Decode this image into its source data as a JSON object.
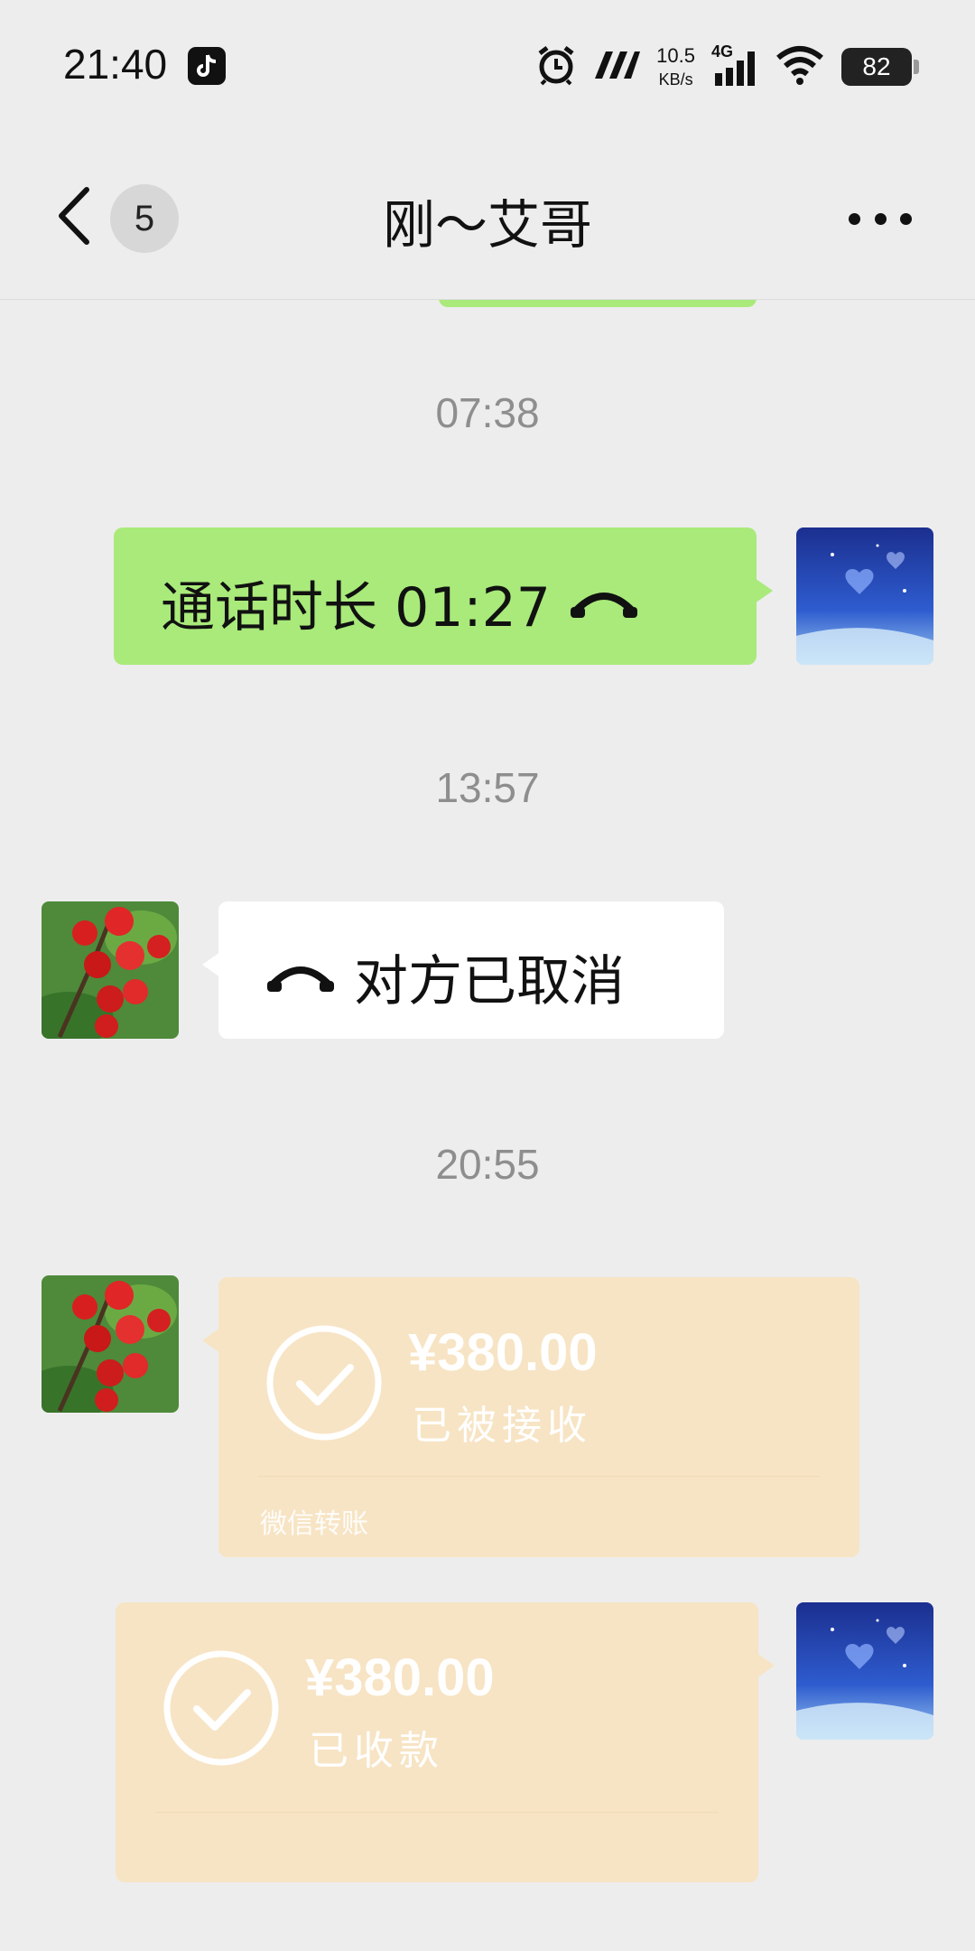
{
  "status_bar": {
    "time": "21:40",
    "net_speed": "10.5",
    "net_unit": "KB/s",
    "network": "4G",
    "battery": "82"
  },
  "nav": {
    "unread_count": "5",
    "title": "刚～艾哥"
  },
  "messages": {
    "ts1": "07:38",
    "call_duration_text": "通话时长 01:27",
    "ts2": "13:57",
    "call_cancel_text": "对方已取消",
    "ts3": "20:55",
    "transfer1": {
      "amount": "¥380.00",
      "status": "已被接收",
      "footer": "微信转账"
    },
    "transfer2": {
      "amount": "¥380.00",
      "status": "已收款"
    }
  },
  "colors": {
    "bubble_green": "#a9ea7a",
    "transfer_faded": "#f7e4c4",
    "background": "#ededed"
  }
}
